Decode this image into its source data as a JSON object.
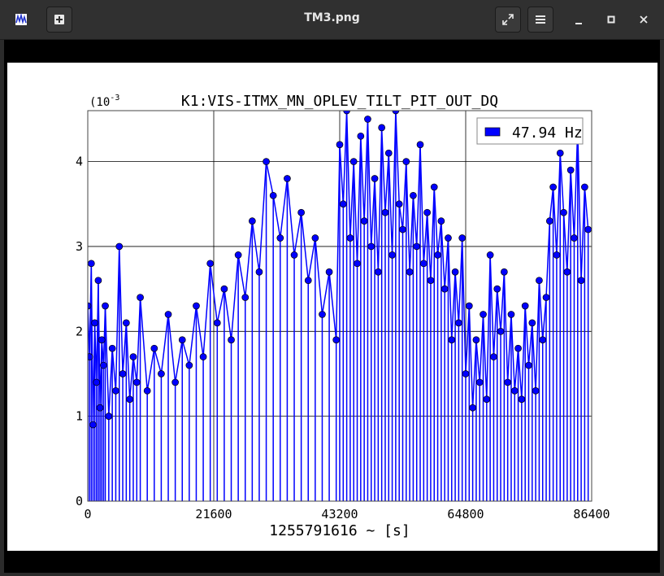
{
  "window": {
    "title": "TM3.png"
  },
  "toolbar": {
    "app_icon": "app-logo-icon",
    "new_icon": "add-icon",
    "fullscreen_icon": "fullscreen-icon",
    "menu_icon": "hamburger-menu-icon",
    "minimize_icon": "minimize-icon",
    "maximize_icon": "maximize-icon",
    "close_icon": "close-icon"
  },
  "chart_data": {
    "type": "scatter",
    "title": "K1:VIS-ITMX_MN_OPLEV_TILT_PIT_OUT_DQ",
    "xlabel": "1255791616 ~ [s]",
    "ylabel": "",
    "y_exponent_label": "(10",
    "y_exponent_power": "-3",
    "xlim": [
      0,
      86400
    ],
    "ylim": [
      0,
      0.0046
    ],
    "x_ticks": [
      0,
      21600,
      43200,
      64800,
      86400
    ],
    "x_tick_labels": [
      "0",
      "21600",
      "43200",
      "64800",
      "86400"
    ],
    "y_ticks": [
      0,
      0.001,
      0.002,
      0.003,
      0.004
    ],
    "y_tick_labels": [
      "0",
      "1",
      "2",
      "3",
      "4"
    ],
    "grid": true,
    "legend_position": "top-right",
    "series": [
      {
        "name": "47.94 Hz",
        "color": "#0000ff",
        "marker_fill": "#0000ff",
        "marker_edge": "#000000",
        "x": [
          0,
          300,
          600,
          900,
          1200,
          1500,
          1800,
          2100,
          2400,
          2700,
          3000,
          3600,
          4200,
          4800,
          5400,
          6000,
          6600,
          7200,
          7800,
          8400,
          9000,
          10200,
          11400,
          12600,
          13800,
          15000,
          16200,
          17400,
          18600,
          19800,
          21000,
          22200,
          23400,
          24600,
          25800,
          27000,
          28200,
          29400,
          30600,
          31800,
          33000,
          34200,
          35400,
          36600,
          37800,
          39000,
          40200,
          41400,
          42600,
          43200,
          43800,
          44400,
          45000,
          45600,
          46200,
          46800,
          47400,
          48000,
          48600,
          49200,
          49800,
          50400,
          51000,
          51600,
          52200,
          52800,
          53400,
          54000,
          54600,
          55200,
          55800,
          56400,
          57000,
          57600,
          58200,
          58800,
          59400,
          60000,
          60600,
          61200,
          61800,
          62400,
          63000,
          63600,
          64200,
          64800,
          65400,
          66000,
          66600,
          67200,
          67800,
          68400,
          69000,
          69600,
          70200,
          70800,
          71400,
          72000,
          72600,
          73200,
          73800,
          74400,
          75000,
          75600,
          76200,
          76800,
          77400,
          78000,
          78600,
          79200,
          79800,
          80400,
          81000,
          81600,
          82200,
          82800,
          83400,
          84000,
          84600,
          85200,
          85800
        ],
        "y": [
          0.0023,
          0.0017,
          0.0028,
          0.0009,
          0.0021,
          0.0014,
          0.0026,
          0.0011,
          0.0019,
          0.0016,
          0.0023,
          0.001,
          0.0018,
          0.0013,
          0.003,
          0.0015,
          0.0021,
          0.0012,
          0.0017,
          0.0014,
          0.0024,
          0.0013,
          0.0018,
          0.0015,
          0.0022,
          0.0014,
          0.0019,
          0.0016,
          0.0023,
          0.0017,
          0.0028,
          0.0021,
          0.0025,
          0.0019,
          0.0029,
          0.0024,
          0.0033,
          0.0027,
          0.004,
          0.0036,
          0.0031,
          0.0038,
          0.0029,
          0.0034,
          0.0026,
          0.0031,
          0.0022,
          0.0027,
          0.0019,
          0.0042,
          0.0035,
          0.0046,
          0.0031,
          0.004,
          0.0028,
          0.0043,
          0.0033,
          0.0045,
          0.003,
          0.0038,
          0.0027,
          0.0044,
          0.0034,
          0.0041,
          0.0029,
          0.0046,
          0.0035,
          0.0032,
          0.004,
          0.0027,
          0.0036,
          0.003,
          0.0042,
          0.0028,
          0.0034,
          0.0026,
          0.0037,
          0.0029,
          0.0033,
          0.0025,
          0.0031,
          0.0019,
          0.0027,
          0.0021,
          0.0031,
          0.0015,
          0.0023,
          0.0011,
          0.0019,
          0.0014,
          0.0022,
          0.0012,
          0.0029,
          0.0017,
          0.0025,
          0.002,
          0.0027,
          0.0014,
          0.0022,
          0.0013,
          0.0018,
          0.0012,
          0.0023,
          0.0016,
          0.0021,
          0.0013,
          0.0026,
          0.0019,
          0.0024,
          0.0033,
          0.0037,
          0.0029,
          0.0041,
          0.0034,
          0.0027,
          0.0039,
          0.0031,
          0.0044,
          0.0026,
          0.0037,
          0.0032
        ]
      }
    ]
  }
}
